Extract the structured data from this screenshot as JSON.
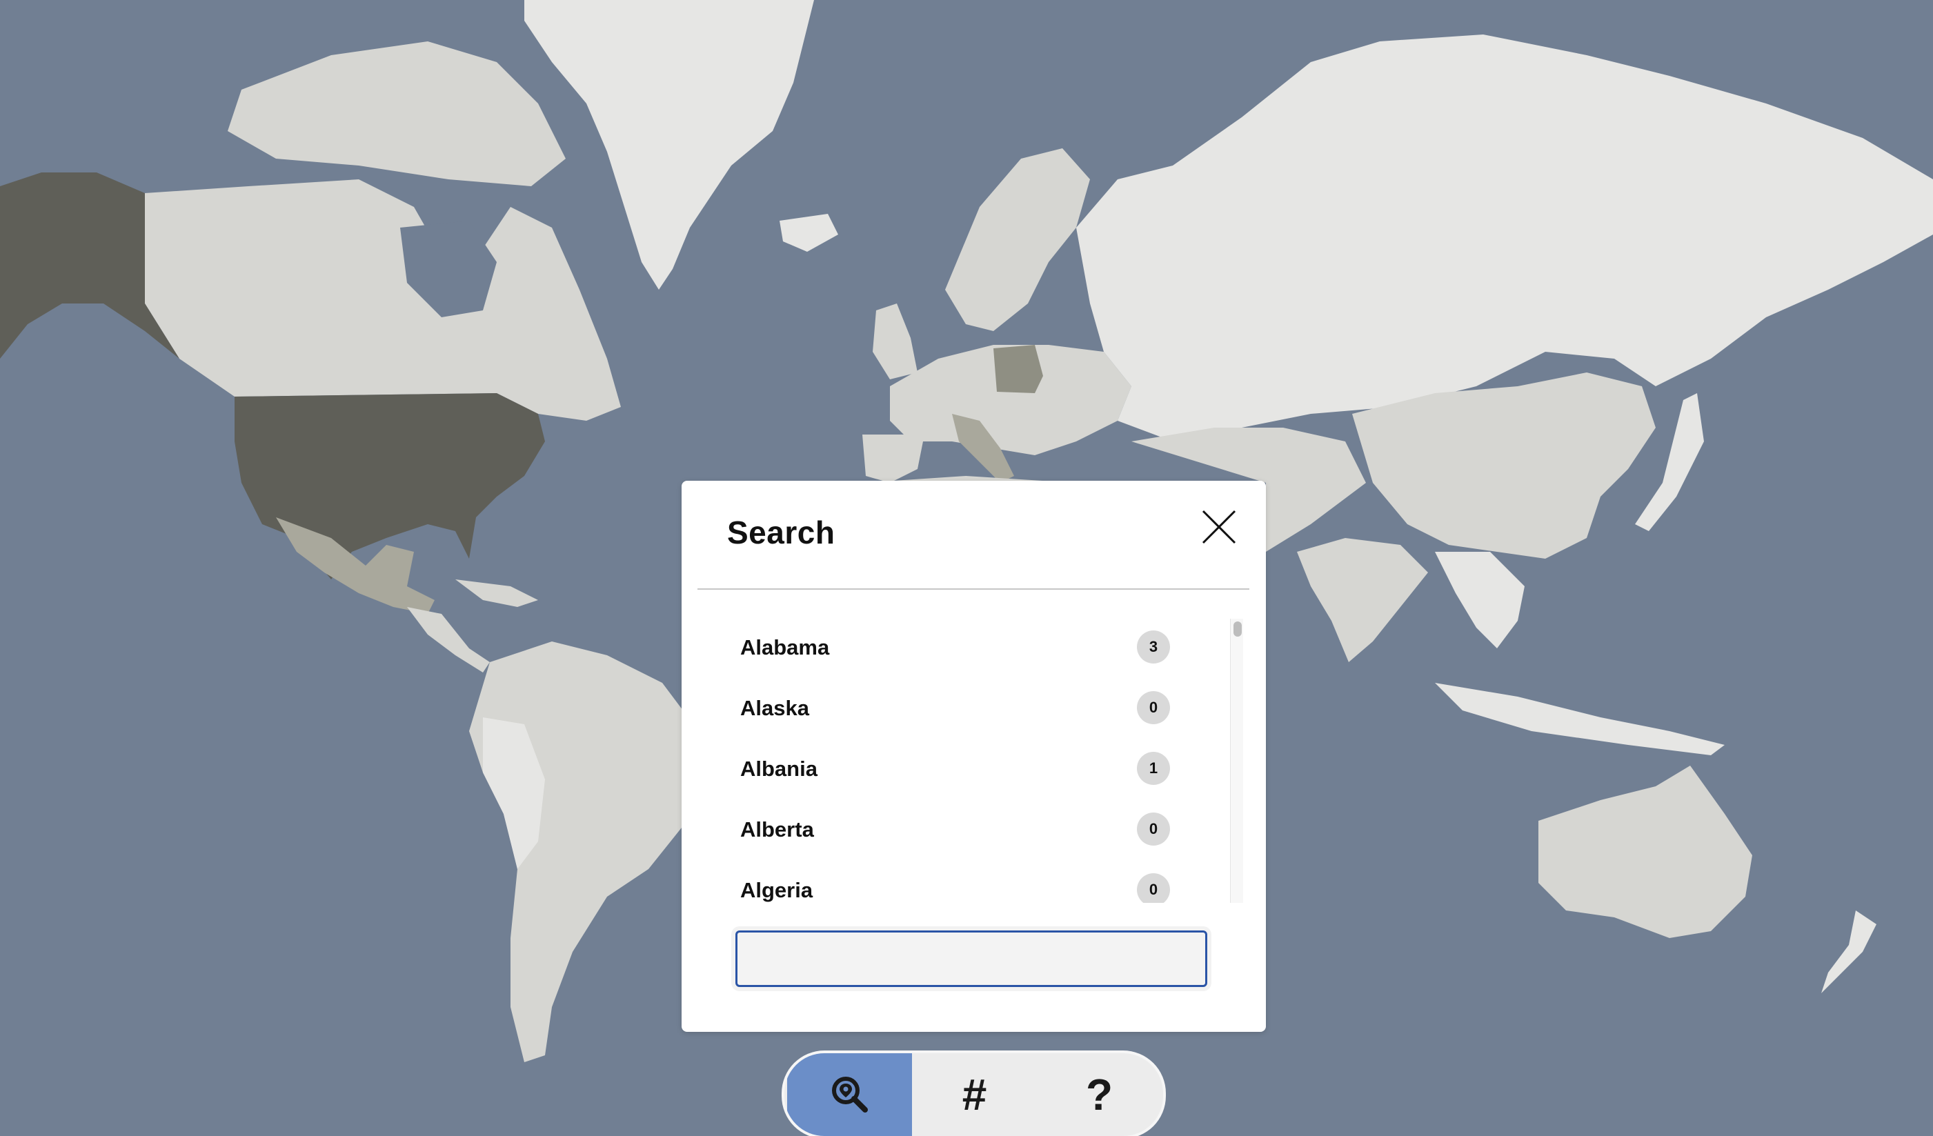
{
  "colors": {
    "ocean": "#717f93",
    "land_default": "#d6d6d2",
    "land_light": "#e6e6e4",
    "land_dark": "#5f5f58",
    "land_mid": "#8f8f83",
    "accent": "#6b8ec8",
    "input_border": "#2a54a6"
  },
  "search_modal": {
    "title": "Search",
    "close_icon": "close-icon",
    "input_value": "",
    "input_placeholder": "",
    "items": [
      {
        "label": "Alabama",
        "count": "3"
      },
      {
        "label": "Alaska",
        "count": "0"
      },
      {
        "label": "Albania",
        "count": "1"
      },
      {
        "label": "Alberta",
        "count": "0"
      },
      {
        "label": "Algeria",
        "count": "0"
      }
    ]
  },
  "toolbar": {
    "search_icon": "map-search-icon",
    "hash_label": "#",
    "help_label": "?"
  }
}
